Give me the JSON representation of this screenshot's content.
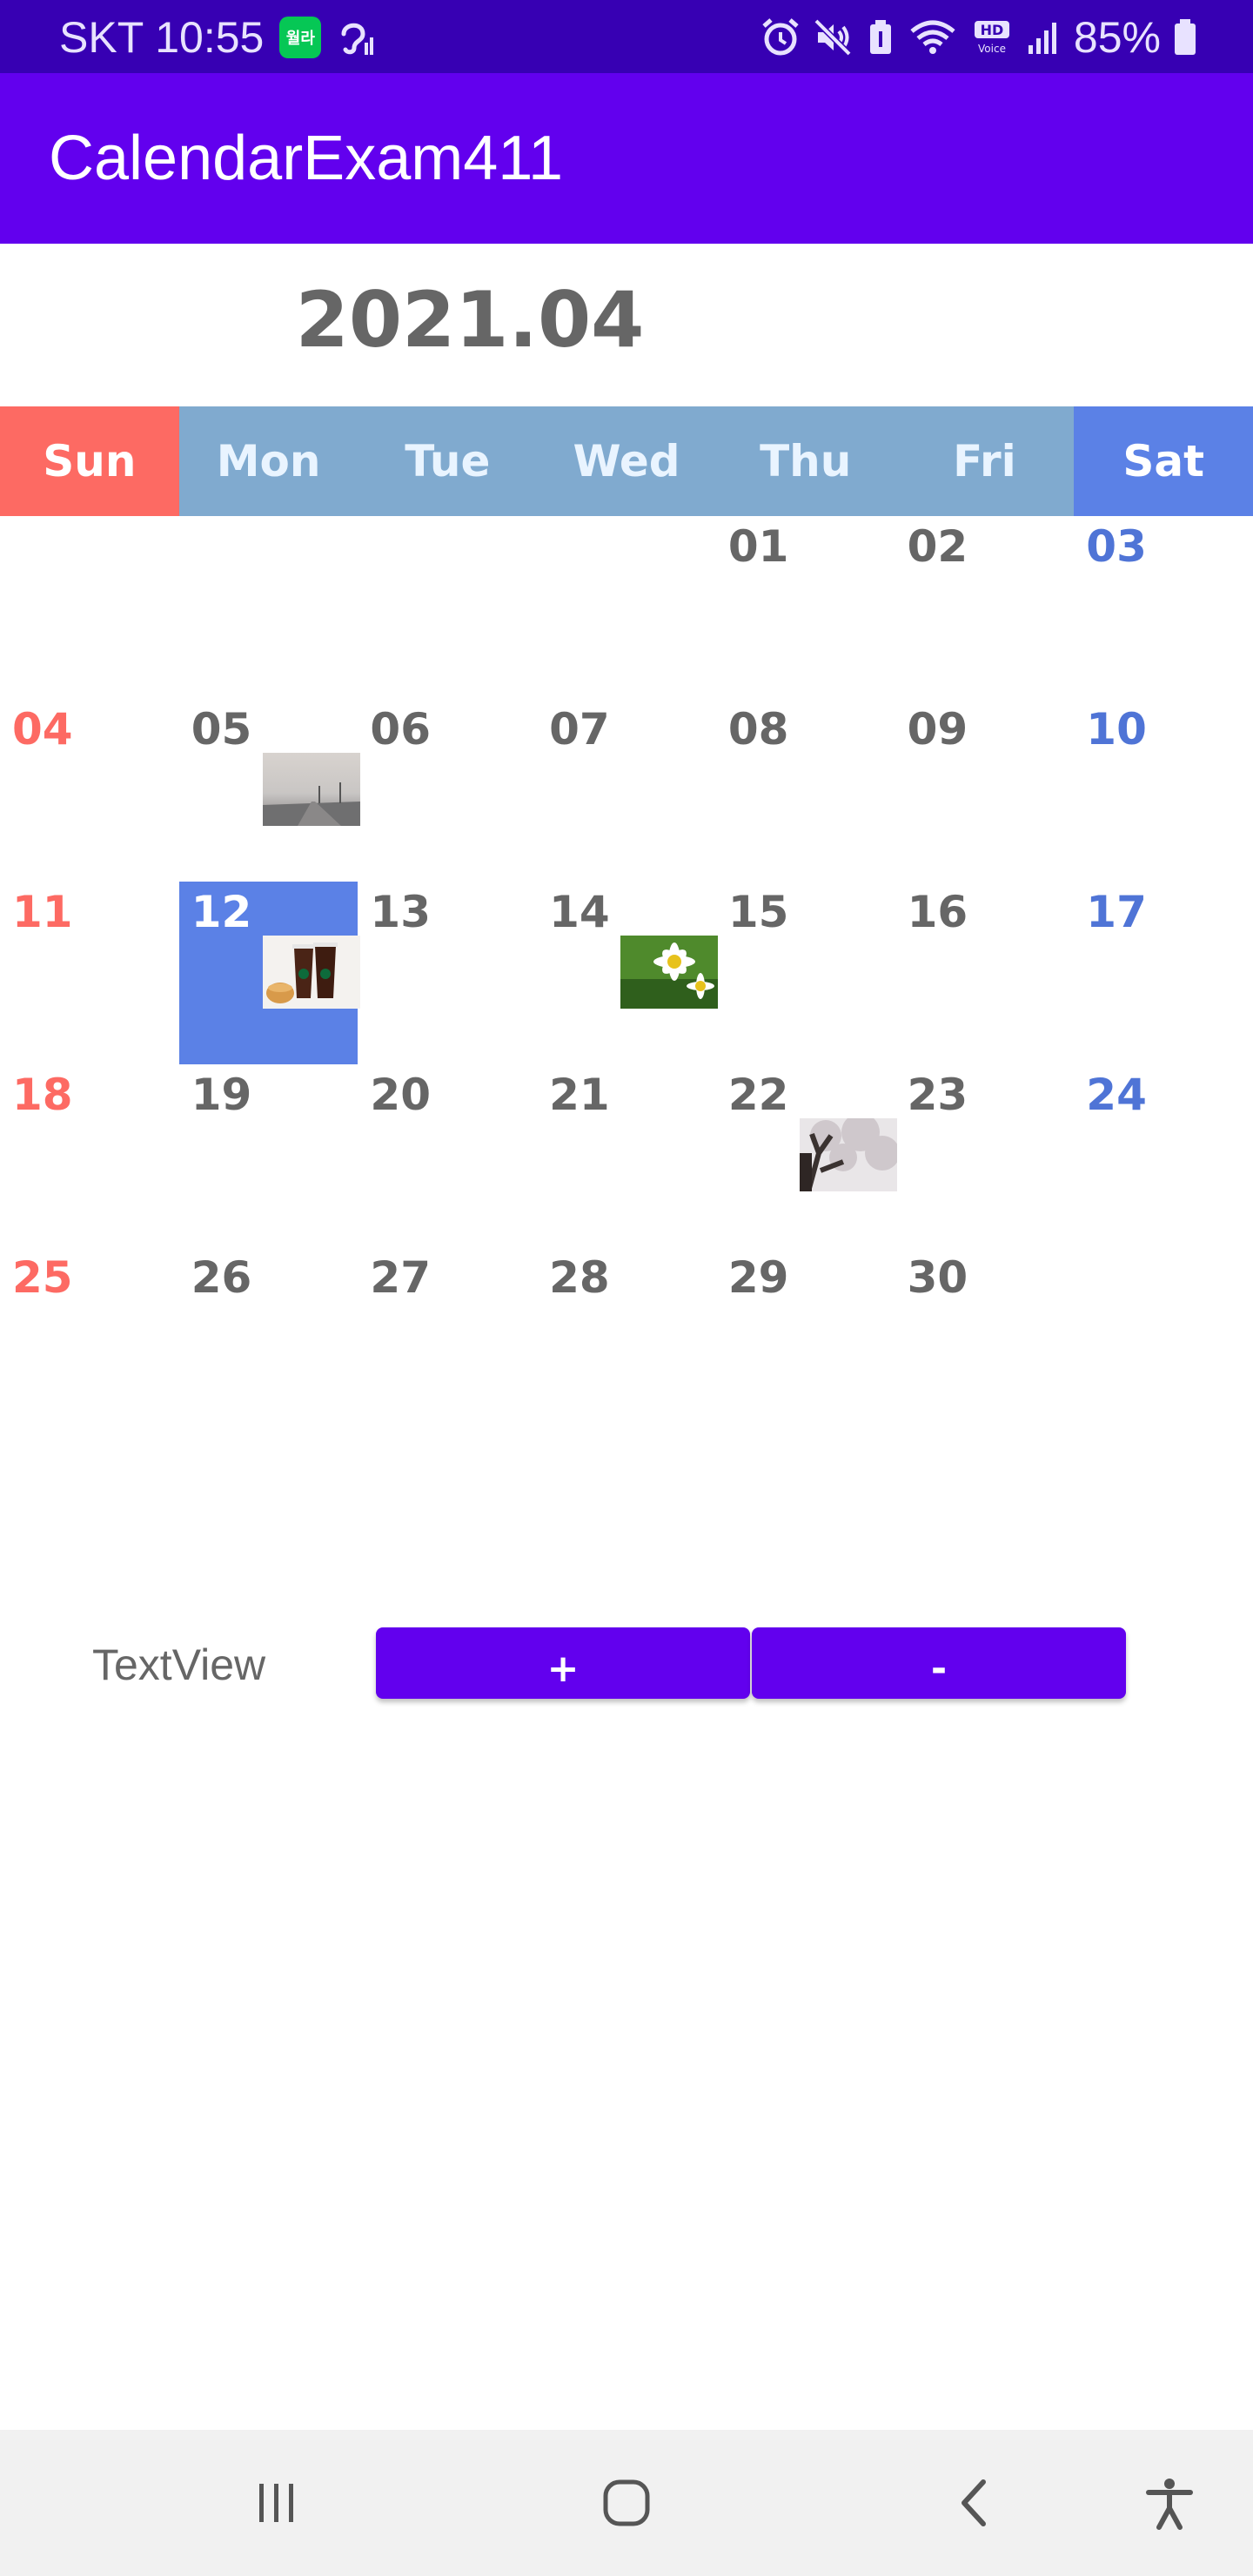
{
  "status_bar": {
    "carrier_time": "SKT 10:55",
    "line_badge": "월라",
    "battery": "85%",
    "icons": [
      "alarm-icon",
      "mute-icon",
      "battery-saver-icon",
      "wifi-icon",
      "hd-voice-icon",
      "signal-icon",
      "battery-icon"
    ]
  },
  "app_bar": {
    "title": "CalendarExam411",
    "color": "#6200ee"
  },
  "calendar": {
    "month_label": "2021.04",
    "weekdays": [
      "Sun",
      "Mon",
      "Tue",
      "Wed",
      "Thu",
      "Fri",
      "Sat"
    ],
    "weeks": [
      [
        "",
        "",
        "",
        "",
        "01",
        "02",
        "03"
      ],
      [
        "04",
        "05",
        "06",
        "07",
        "08",
        "09",
        "10"
      ],
      [
        "11",
        "12",
        "13",
        "14",
        "15",
        "16",
        "17"
      ],
      [
        "18",
        "19",
        "20",
        "21",
        "22",
        "23",
        "24"
      ],
      [
        "25",
        "26",
        "27",
        "28",
        "29",
        "30",
        ""
      ]
    ],
    "selected_day": "12",
    "colors": {
      "sunday": "#fd6a63",
      "saturday": "#5b81e6",
      "weekday_header": "#80aacf",
      "selected": "#5b81e6"
    },
    "thumbnails": [
      {
        "day": "05",
        "subject": "foggy road photo"
      },
      {
        "day": "12",
        "subject": "iced coffee cups photo"
      },
      {
        "day": "14",
        "subject": "daisy flowers photo"
      },
      {
        "day": "22",
        "subject": "cherry blossom tree photo"
      }
    ]
  },
  "controls": {
    "text_view": "TextView",
    "plus_label": "+",
    "minus_label": "-"
  },
  "nav_bar": {
    "icons": [
      "recent-apps-icon",
      "home-icon",
      "back-icon",
      "accessibility-icon"
    ]
  }
}
